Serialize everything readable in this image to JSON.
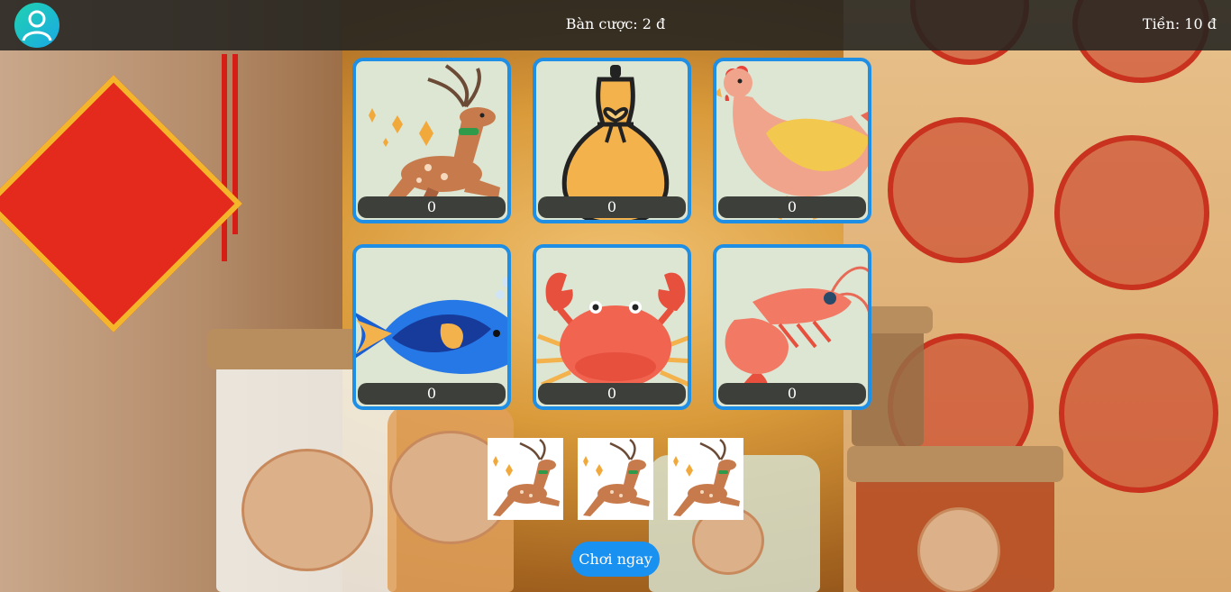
{
  "header": {
    "bet_label": "Bàn cược: 2 đ",
    "money_label": "Tiền: 10 đ",
    "avatar_icon": "user-icon"
  },
  "board": {
    "cards": [
      {
        "animal": "deer",
        "icon": "deer-icon",
        "count": "0"
      },
      {
        "animal": "gourd",
        "icon": "gourd-icon",
        "count": "0"
      },
      {
        "animal": "chicken",
        "icon": "chicken-icon",
        "count": "0"
      },
      {
        "animal": "fish",
        "icon": "fish-icon",
        "count": "0"
      },
      {
        "animal": "crab",
        "icon": "crab-icon",
        "count": "0"
      },
      {
        "animal": "shrimp",
        "icon": "shrimp-icon",
        "count": "0"
      }
    ]
  },
  "results": [
    {
      "animal": "deer",
      "icon": "deer-icon"
    },
    {
      "animal": "deer",
      "icon": "deer-icon"
    },
    {
      "animal": "deer",
      "icon": "deer-icon"
    }
  ],
  "play_button": {
    "label": "Chơi ngay"
  },
  "colors": {
    "card_border": "#1f8fe6",
    "card_bg": "#dde5d3",
    "button": "#1991f0",
    "topbar": "#232320"
  }
}
